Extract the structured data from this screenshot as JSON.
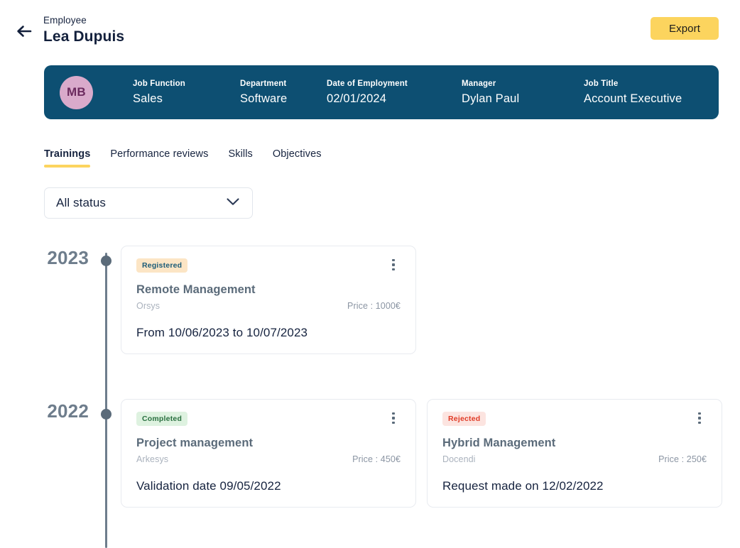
{
  "header": {
    "back_icon": "arrow-left-icon",
    "eyebrow": "Employee",
    "name": "Lea Dupuis",
    "export_label": "Export",
    "export_color": "#FCD45E"
  },
  "banner": {
    "background_color": "#0D4F72",
    "avatar": {
      "initials": "MB",
      "background_color": "#D9AACB",
      "text_color": "#6B2A5E"
    },
    "fields": [
      {
        "label": "Job Function",
        "value": "Sales"
      },
      {
        "label": "Department",
        "value": "Software"
      },
      {
        "label": "Date of Employment",
        "value": "02/01/2024"
      },
      {
        "label": "Manager",
        "value": "Dylan Paul"
      },
      {
        "label": "Job Title",
        "value": "Account Executive"
      }
    ]
  },
  "tabs": {
    "active_index": 0,
    "underline_color": "#FCD45E",
    "items": [
      {
        "label": "Trainings"
      },
      {
        "label": "Performance reviews"
      },
      {
        "label": "Skills"
      },
      {
        "label": "Objectives"
      }
    ]
  },
  "status_filter": {
    "selected": "All status",
    "chevron_icon": "chevron-down-icon"
  },
  "timeline": {
    "line_color": "#6E7D8C",
    "groups": [
      {
        "year": "2023",
        "cards": [
          {
            "status": "Registered",
            "status_variant": "registered",
            "title": "Remote Management",
            "provider": "Orsys",
            "price": "Price : 1000€",
            "date": "From 10/06/2023 to 10/07/2023",
            "menu_icon": "kebab-menu-icon"
          }
        ]
      },
      {
        "year": "2022",
        "cards": [
          {
            "status": "Completed",
            "status_variant": "completed",
            "title": "Project management",
            "provider": "Arkesys",
            "price": "Price : 450€",
            "date": "Validation date 09/05/2022",
            "menu_icon": "kebab-menu-icon"
          },
          {
            "status": "Rejected",
            "status_variant": "rejected",
            "title": "Hybrid Management",
            "provider": "Docendi",
            "price": "Price : 250€",
            "date": "Request made on 12/02/2022",
            "menu_icon": "kebab-menu-icon"
          }
        ]
      }
    ]
  }
}
